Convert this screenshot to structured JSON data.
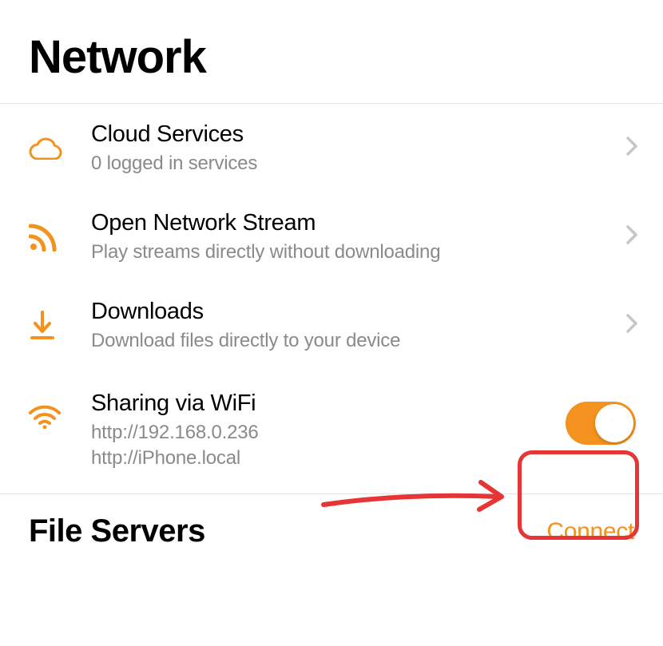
{
  "header": {
    "title": "Network"
  },
  "rows": {
    "cloud": {
      "title": "Cloud Services",
      "subtitle": "0 logged in services"
    },
    "stream": {
      "title": "Open Network Stream",
      "subtitle": "Play streams directly without downloading"
    },
    "downloads": {
      "title": "Downloads",
      "subtitle": "Download files directly to your device"
    },
    "sharing": {
      "title": "Sharing via WiFi",
      "url1": "http://192.168.0.236",
      "url2": "http://iPhone.local",
      "toggle_on": true
    }
  },
  "footer": {
    "title": "File Servers",
    "action": "Connect"
  },
  "colors": {
    "accent": "#f3921e",
    "annotation": "#e73434"
  }
}
